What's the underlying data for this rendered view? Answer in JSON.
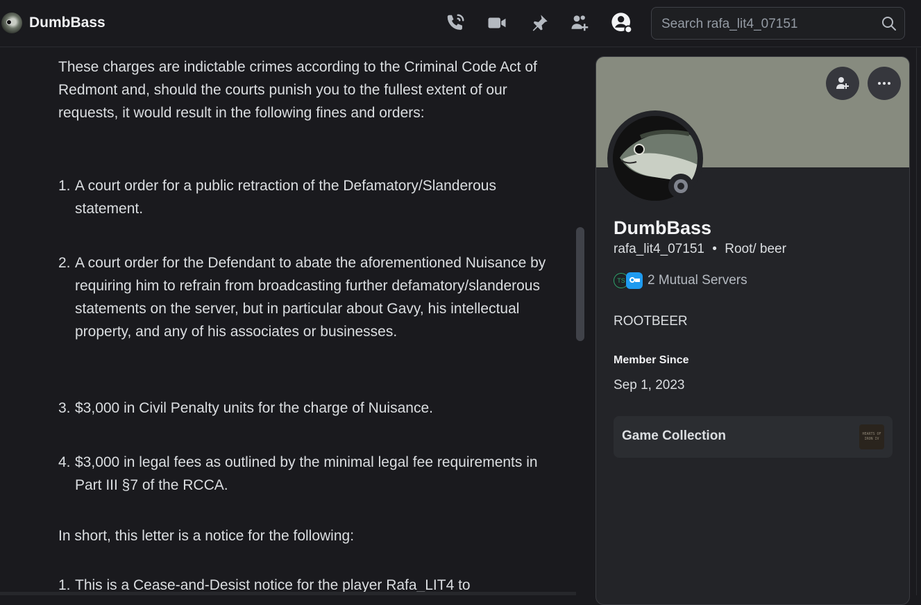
{
  "header": {
    "title": "DumbBass",
    "search_placeholder": "Search rafa_lit4_07151",
    "icons": [
      "phone-call-icon",
      "video-camera-icon",
      "pin-icon",
      "add-friend-icon",
      "profile-toggle-icon",
      "search-icon"
    ]
  },
  "message": {
    "intro": "These charges are indictable crimes according to the Criminal Code Act of Redmont and, should the courts punish you to the fullest extent of our requests, it would result in the following fines and orders:",
    "orders": [
      {
        "num": "1.",
        "text": "A court order for a public retraction of the Defamatory/Slanderous statement."
      },
      {
        "num": "2.",
        "text": "A court order for the Defendant to abate the aforementioned Nuisance by requiring him to refrain from broadcasting further defamatory/slanderous statements on the server, but in particular about Gavy, his intellectual property, and any of his associates or businesses."
      },
      {
        "num": "3.",
        "text": "$3,000 in Civil Penalty units for the charge of Nuisance."
      },
      {
        "num": "4.",
        "text": "$3,000 in legal fees as outlined by the minimal legal fee requirements in Part III §7 of the RCCA."
      }
    ],
    "summary": "In short, this letter is a notice for the following:",
    "notice": {
      "num": "1.",
      "text": "This is a Cease-and-Desist notice for the player Rafa_LIT4 to"
    }
  },
  "profile": {
    "display_name": "DumbBass",
    "username": "rafa_lit4_07151",
    "separator": "•",
    "pronouns": "Root/ beer",
    "mutual_servers": "2 Mutual Servers",
    "server_badge_1": "TS",
    "bio": "ROOTBEER",
    "member_since_label": "Member Since",
    "member_since": "Sep 1, 2023",
    "game_collection_label": "Game Collection",
    "game_thumb_text": "HEARTS OF IRON IV",
    "status": "offline",
    "banner_color": "#878b7f"
  }
}
